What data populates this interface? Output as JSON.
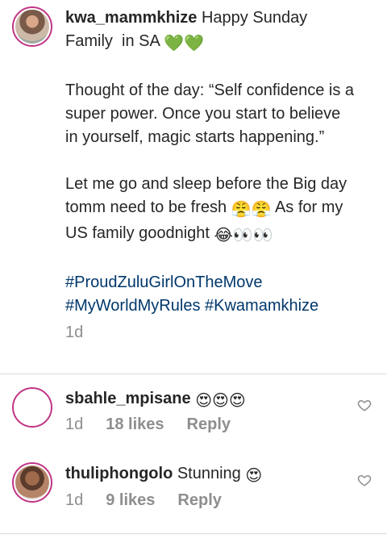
{
  "post": {
    "username": "kwa_mammkhize",
    "line1_rest": "Happy Sunday",
    "line2": "Family  in SA",
    "heart_emojis": "💚💚",
    "quote": "Thought of the day: “Self confidence is a super power. Once you start to believe in yourself, magic starts happening.”",
    "sleep_text_a": "Let me go and sleep before the Big day tomm need to be fresh",
    "sleep_emojis_a": "😤😤",
    "sleep_text_b": "As for my US family goodnight",
    "sleep_emojis_b": "😂👀👀",
    "hashtag1": "#ProudZuluGirlOnTheMove",
    "hashtag2": "#MyWorldMyRules",
    "hashtag3": "#Kwamamkhize",
    "time": "1d"
  },
  "comments": [
    {
      "username": "sbahle_mpisane",
      "text": "",
      "emojis": "😍😍😍",
      "time": "1d",
      "likes": "18 likes",
      "reply": "Reply"
    },
    {
      "username": "thuliphongolo",
      "text": "Stunning",
      "emojis": "😍",
      "time": "1d",
      "likes": "9 likes",
      "reply": "Reply"
    }
  ],
  "icons": {
    "like": "heart-outline-icon"
  }
}
